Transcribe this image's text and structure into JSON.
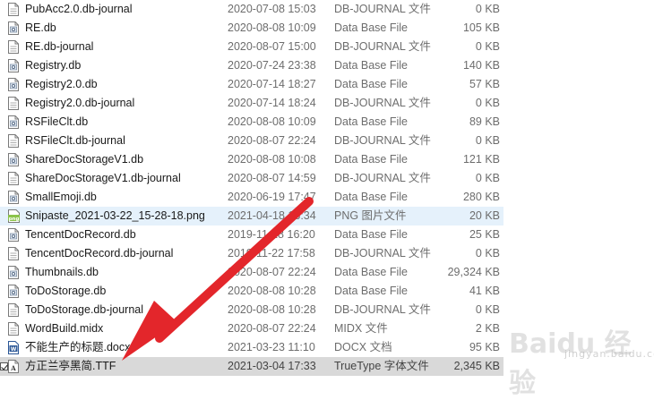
{
  "files": [
    {
      "name": "PubAcc2.0.db-journal",
      "date": "2020-07-08 15:03",
      "type": "DB-JOURNAL 文件",
      "size": "0 KB",
      "icon": "file-icon"
    },
    {
      "name": "RE.db",
      "date": "2020-08-08 10:09",
      "type": "Data Base File",
      "size": "105 KB",
      "icon": "db-file-icon"
    },
    {
      "name": "RE.db-journal",
      "date": "2020-08-07 15:00",
      "type": "DB-JOURNAL 文件",
      "size": "0 KB",
      "icon": "file-icon"
    },
    {
      "name": "Registry.db",
      "date": "2020-07-24 23:38",
      "type": "Data Base File",
      "size": "140 KB",
      "icon": "db-file-icon"
    },
    {
      "name": "Registry2.0.db",
      "date": "2020-07-14 18:27",
      "type": "Data Base File",
      "size": "57 KB",
      "icon": "db-file-icon"
    },
    {
      "name": "Registry2.0.db-journal",
      "date": "2020-07-14 18:24",
      "type": "DB-JOURNAL 文件",
      "size": "0 KB",
      "icon": "file-icon"
    },
    {
      "name": "RSFileClt.db",
      "date": "2020-08-08 10:09",
      "type": "Data Base File",
      "size": "89 KB",
      "icon": "db-file-icon"
    },
    {
      "name": "RSFileClt.db-journal",
      "date": "2020-08-07 22:24",
      "type": "DB-JOURNAL 文件",
      "size": "0 KB",
      "icon": "file-icon"
    },
    {
      "name": "ShareDocStorageV1.db",
      "date": "2020-08-08 10:08",
      "type": "Data Base File",
      "size": "121 KB",
      "icon": "db-file-icon"
    },
    {
      "name": "ShareDocStorageV1.db-journal",
      "date": "2020-08-07 14:59",
      "type": "DB-JOURNAL 文件",
      "size": "0 KB",
      "icon": "file-icon"
    },
    {
      "name": "SmallEmoji.db",
      "date": "2020-06-19 17:47",
      "type": "Data Base File",
      "size": "280 KB",
      "icon": "db-file-icon"
    },
    {
      "name": "Snipaste_2021-03-22_15-28-18.png",
      "date": "2021-04-18 16:34",
      "type": "PNG 图片文件",
      "size": "20 KB",
      "icon": "png-icon",
      "state": "highlight"
    },
    {
      "name": "TencentDocRecord.db",
      "date": "2019-11-28 16:20",
      "type": "Data Base File",
      "size": "25 KB",
      "icon": "db-file-icon"
    },
    {
      "name": "TencentDocRecord.db-journal",
      "date": "2019-11-22 17:58",
      "type": "DB-JOURNAL 文件",
      "size": "0 KB",
      "icon": "file-icon"
    },
    {
      "name": "Thumbnails.db",
      "date": "2020-08-07 22:24",
      "type": "Data Base File",
      "size": "29,324 KB",
      "icon": "db-file-icon"
    },
    {
      "name": "ToDoStorage.db",
      "date": "2020-08-08 10:28",
      "type": "Data Base File",
      "size": "41 KB",
      "icon": "db-file-icon"
    },
    {
      "name": "ToDoStorage.db-journal",
      "date": "2020-08-08 10:28",
      "type": "DB-JOURNAL 文件",
      "size": "0 KB",
      "icon": "file-icon"
    },
    {
      "name": "WordBuild.midx",
      "date": "2020-08-07 22:24",
      "type": "MIDX 文件",
      "size": "2 KB",
      "icon": "file-icon"
    },
    {
      "name": "不能生产的标题.docx",
      "date": "2021-03-23 11:10",
      "type": "DOCX 文档",
      "size": "95 KB",
      "icon": "docx-icon"
    },
    {
      "name": "方正兰亭黑简.TTF",
      "date": "2021-03-04 17:33",
      "type": "TrueType 字体文件",
      "size": "2,345 KB",
      "icon": "font-file-icon",
      "state": "selected"
    }
  ],
  "watermark": {
    "text": "Baidu 经验",
    "sub": "jingyan.baidu.com"
  },
  "colors": {
    "arrow": "#e3262b",
    "highlight": "#e5f1fb",
    "selected": "#d9d9d9"
  }
}
